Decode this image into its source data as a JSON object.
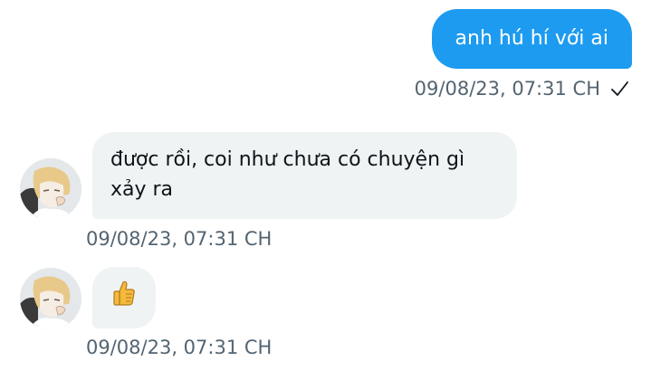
{
  "messages": [
    {
      "direction": "outgoing",
      "text": "anh hú hí với ai",
      "timestamp": "09/08/23, 07:31 CH",
      "status_icon": "check-icon"
    },
    {
      "direction": "incoming",
      "text": "được rồi, coi như chưa có chuyện gì xảy ra",
      "timestamp": "09/08/23, 07:31 CH",
      "avatar_icon": "avatar"
    },
    {
      "direction": "incoming",
      "emoji": "👍",
      "emoji_icon": "thumbs-up-icon",
      "timestamp": "09/08/23, 07:31 CH",
      "avatar_icon": "avatar"
    }
  ],
  "colors": {
    "outgoing_bubble": "#1d9bf0",
    "incoming_bubble": "#eff3f4",
    "timestamp_text": "#536471",
    "message_text": "#0f1419"
  }
}
